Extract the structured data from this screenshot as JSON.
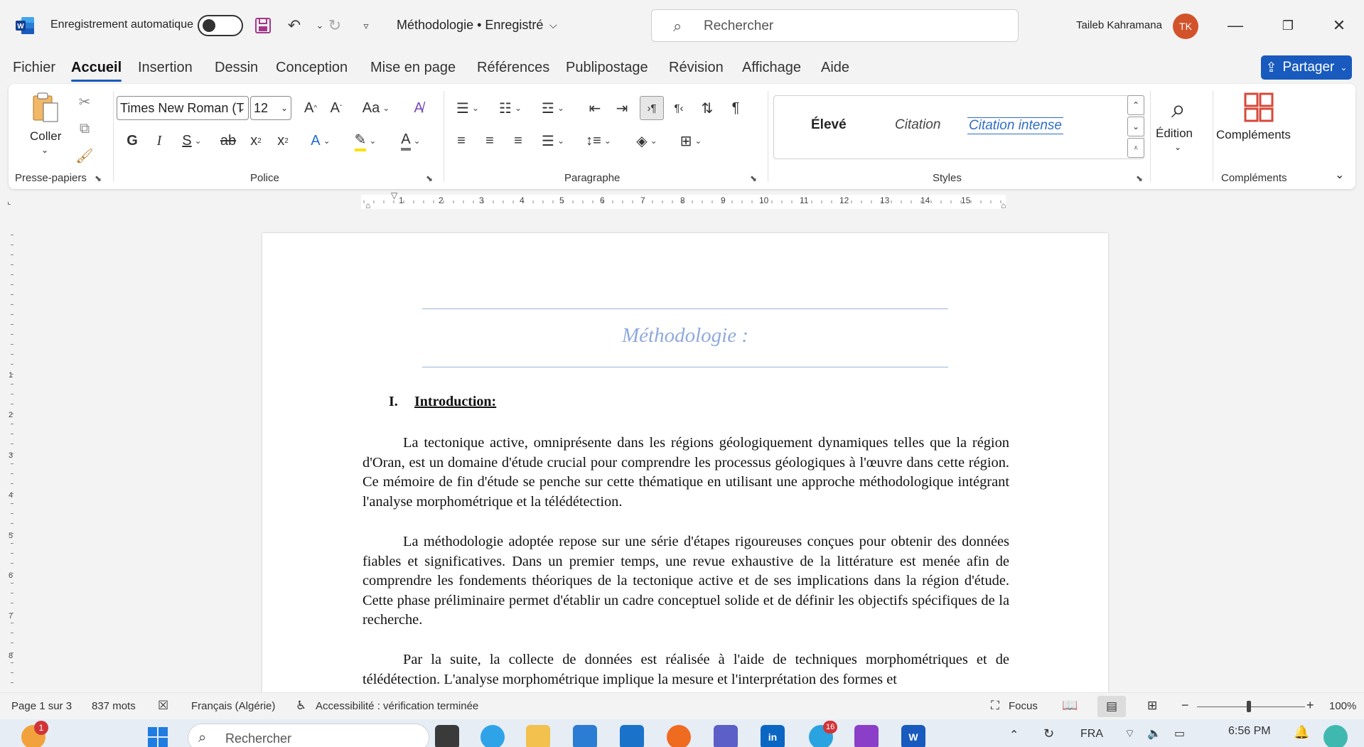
{
  "titlebar": {
    "autosave_label": "Enregistrement automatique",
    "document_title": "Méthodologie • Enregistré",
    "search_placeholder": "Rechercher",
    "user_name": "Taileb Kahramana",
    "user_initials": "TK"
  },
  "tabs": [
    "Fichier",
    "Accueil",
    "Insertion",
    "Dessin",
    "Conception",
    "Mise en page",
    "Références",
    "Publipostage",
    "Révision",
    "Affichage",
    "Aide"
  ],
  "active_tab": "Accueil",
  "share_label": "Partager",
  "ribbon": {
    "clipboard": {
      "paste_label": "Coller",
      "group_label": "Presse-papiers"
    },
    "font": {
      "family": "Times New Roman (T",
      "size": "12",
      "group_label": "Police"
    },
    "paragraph": {
      "group_label": "Paragraphe"
    },
    "styles": {
      "items": [
        "Élevé",
        "Citation",
        "Citation intense"
      ],
      "group_label": "Styles"
    },
    "editing": {
      "label": "Édition"
    },
    "addins": {
      "label": "Compléments",
      "group_label": "Compléments"
    }
  },
  "ruler_numbers": [
    "1",
    "2",
    "3",
    "4",
    "5",
    "6",
    "7",
    "8",
    "9",
    "10",
    "11",
    "12",
    "13",
    "14",
    "15"
  ],
  "left_ruler_numbers": [
    "1",
    "2",
    "3",
    "4",
    "5",
    "6",
    "7",
    "8"
  ],
  "document": {
    "title": "Méthodologie :",
    "heading_number": "I.",
    "heading_text": "Introduction:",
    "paragraphs": [
      "La tectonique active, omniprésente dans les régions géologiquement dynamiques telles que la région d'Oran, est un domaine d'étude crucial pour comprendre les processus géologiques à l'œuvre dans cette région. Ce mémoire de fin d'étude se penche sur cette thématique en utilisant une approche méthodologique intégrant l'analyse morphométrique et la télédétection.",
      "La méthodologie adoptée repose sur une série d'étapes rigoureuses conçues pour obtenir des données fiables et significatives. Dans un premier temps, une revue exhaustive de la littérature est menée afin de comprendre les fondements théoriques de la tectonique active et de ses implications dans la région d'étude. Cette phase préliminaire permet d'établir un cadre conceptuel solide et de définir les objectifs spécifiques de la recherche.",
      "Par la suite, la collecte de données est réalisée à l'aide de techniques morphométriques et de télédétection. L'analyse morphométrique implique la mesure et l'interprétation des formes et"
    ]
  },
  "statusbar": {
    "page": "Page 1 sur 3",
    "words": "837 mots",
    "language": "Français (Algérie)",
    "accessibility": "Accessibilité : vérification terminée",
    "focus": "Focus",
    "zoom": "100%"
  },
  "taskbar": {
    "search_placeholder": "Rechercher",
    "notification_count": "1",
    "telegram_badge": "16",
    "language": "FRA",
    "time": "6:56 PM"
  },
  "colors": {
    "accent": "#185abd",
    "title_color": "#8fa9de",
    "avatar": "#d2532b"
  }
}
